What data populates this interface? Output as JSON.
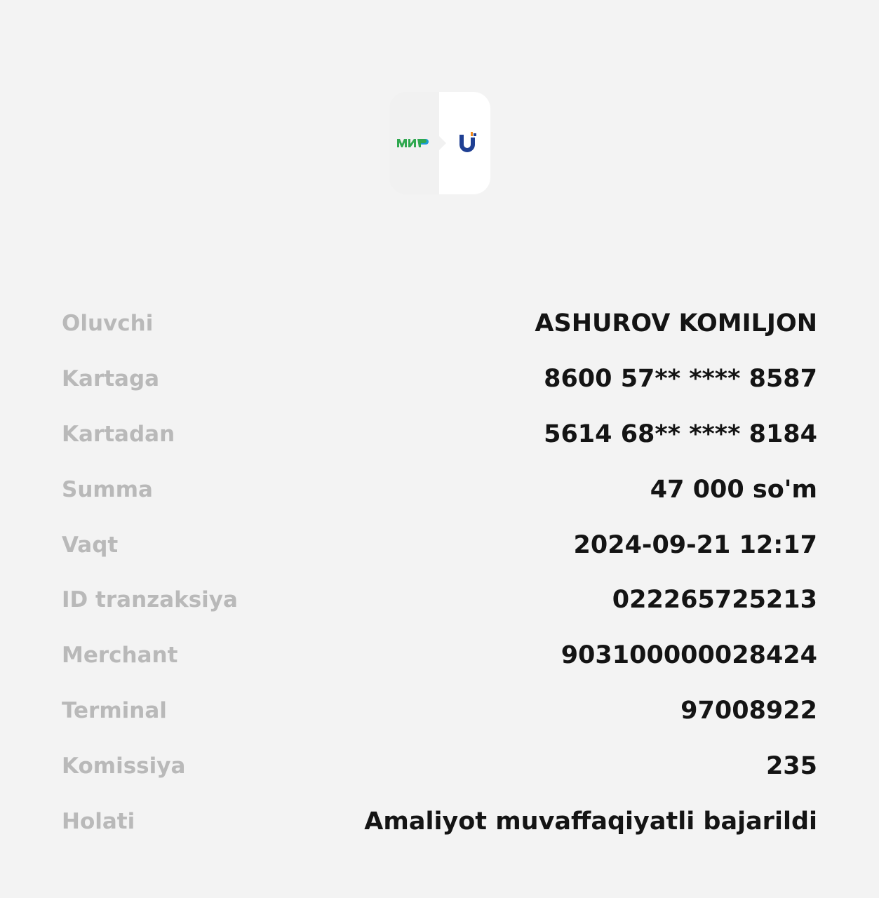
{
  "logos": {
    "from_card_logo": "mir-logo",
    "to_card_logo": "uzcard-logo",
    "mir_color": "#2fa84f",
    "uzcard_color": "#1f3f93",
    "uzcard_accent": "#f08a1e"
  },
  "details": {
    "recipient": {
      "label": "Oluvchi",
      "value": "ASHUROV KOMILJON"
    },
    "to_card": {
      "label": "Kartaga",
      "value": "8600 57** **** 8587"
    },
    "from_card": {
      "label": "Kartadan",
      "value": "5614 68** **** 8184"
    },
    "amount": {
      "label": "Summa",
      "value": "47 000 so'm"
    },
    "time": {
      "label": "Vaqt",
      "value": "2024-09-21 12:17"
    },
    "transaction_id": {
      "label": "ID tranzaksiya",
      "value": "022265725213"
    },
    "merchant": {
      "label": "Merchant",
      "value": "903100000028424"
    },
    "terminal": {
      "label": "Terminal",
      "value": "97008922"
    },
    "commission": {
      "label": "Komissiya",
      "value": "235"
    },
    "status": {
      "label": "Holati",
      "value": "Amaliyot muvaffaqiyatli bajarildi"
    }
  }
}
